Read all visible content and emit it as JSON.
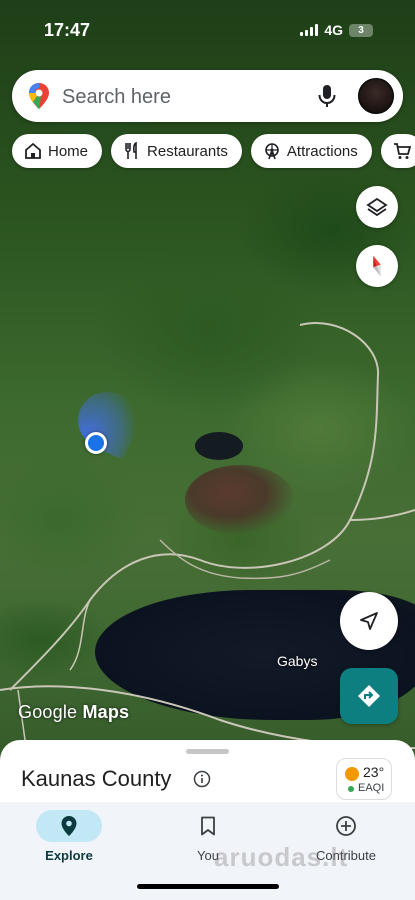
{
  "status_bar": {
    "time": "17:47",
    "network": "4G",
    "battery": "3"
  },
  "search": {
    "placeholder": "Search here"
  },
  "chips": [
    {
      "label": "Home",
      "icon": "home-icon"
    },
    {
      "label": "Restaurants",
      "icon": "fork-knife-icon"
    },
    {
      "label": "Attractions",
      "icon": "ferris-wheel-icon"
    },
    {
      "label": "",
      "icon": "shopping-cart-icon"
    }
  ],
  "map": {
    "place_label": "Gabys",
    "attribution_light": "Google",
    "attribution_bold": "Maps"
  },
  "sheet": {
    "title": "Kaunas County",
    "weather_temp": "23°",
    "weather_aqi": "EAQI"
  },
  "nav": {
    "explore": "Explore",
    "you": "You",
    "contribute": "Contribute"
  },
  "watermark": "aruodas.lt",
  "colors": {
    "accent": "#0d7f80",
    "nav_active": "#c2e7f5",
    "location_blue": "#1a73e8"
  }
}
